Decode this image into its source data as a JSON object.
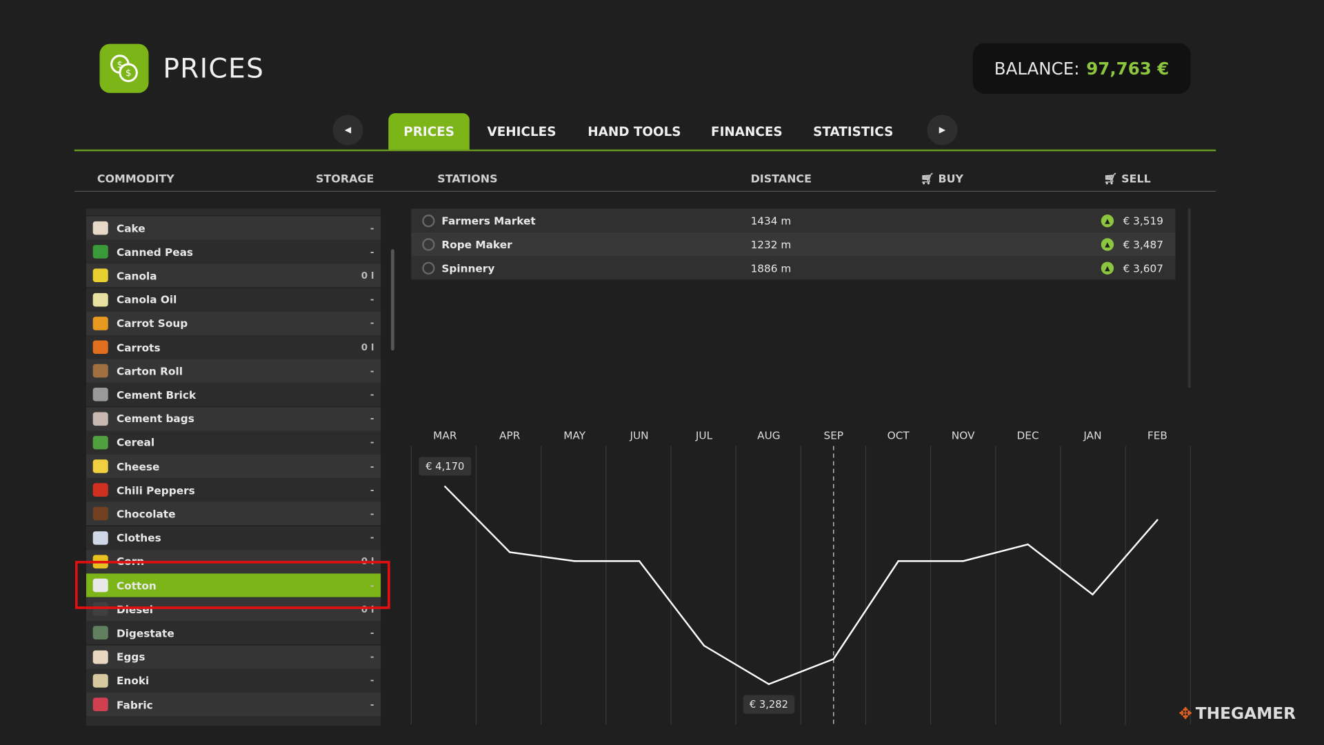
{
  "header": {
    "title": "PRICES",
    "balance_label": "BALANCE:",
    "balance_value": "97,763 €"
  },
  "tabs": [
    {
      "label": "PRICES",
      "active": true
    },
    {
      "label": "VEHICLES"
    },
    {
      "label": "HAND TOOLS"
    },
    {
      "label": "FINANCES"
    },
    {
      "label": "STATISTICS"
    }
  ],
  "columns": {
    "commodity": "COMMODITY",
    "storage": "STORAGE",
    "stations": "STATIONS",
    "distance": "DISTANCE",
    "buy": "BUY",
    "sell": "SELL"
  },
  "commodities": [
    {
      "name": "Cake",
      "storage": "-",
      "color": "#e8d8c8"
    },
    {
      "name": "Canned Peas",
      "storage": "-",
      "color": "#3a9a3a"
    },
    {
      "name": "Canola",
      "storage": "0 l",
      "color": "#e8d030"
    },
    {
      "name": "Canola Oil",
      "storage": "-",
      "color": "#e8e0a0"
    },
    {
      "name": "Carrot Soup",
      "storage": "-",
      "color": "#e89a20"
    },
    {
      "name": "Carrots",
      "storage": "0 l",
      "color": "#e07020"
    },
    {
      "name": "Carton Roll",
      "storage": "-",
      "color": "#a07040"
    },
    {
      "name": "Cement Brick",
      "storage": "-",
      "color": "#999999"
    },
    {
      "name": "Cement bags",
      "storage": "-",
      "color": "#c8b8b0"
    },
    {
      "name": "Cereal",
      "storage": "-",
      "color": "#50a040"
    },
    {
      "name": "Cheese",
      "storage": "-",
      "color": "#f0d040"
    },
    {
      "name": "Chili Peppers",
      "storage": "-",
      "color": "#d03020"
    },
    {
      "name": "Chocolate",
      "storage": "-",
      "color": "#704020"
    },
    {
      "name": "Clothes",
      "storage": "-",
      "color": "#d0d8e8"
    },
    {
      "name": "Corn",
      "storage": "0 l",
      "color": "#e8c020"
    },
    {
      "name": "Cotton",
      "storage": "-",
      "color": "#e8e8e8",
      "selected": true
    },
    {
      "name": "Diesel",
      "storage": "0 l",
      "color": "#404040"
    },
    {
      "name": "Digestate",
      "storage": "-",
      "color": "#608060"
    },
    {
      "name": "Eggs",
      "storage": "-",
      "color": "#e8d8c0"
    },
    {
      "name": "Enoki",
      "storage": "-",
      "color": "#d8c8a0"
    },
    {
      "name": "Fabric",
      "storage": "-",
      "color": "#d04050"
    }
  ],
  "stations": [
    {
      "name": "Farmers Market",
      "distance": "1434 m",
      "sell": "€ 3,519"
    },
    {
      "name": "Rope Maker",
      "distance": "1232 m",
      "sell": "€ 3,487"
    },
    {
      "name": "Spinnery",
      "distance": "1886 m",
      "sell": "€ 3,607"
    }
  ],
  "chart_data": {
    "type": "line",
    "categories": [
      "MAR",
      "APR",
      "MAY",
      "JUN",
      "JUL",
      "AUG",
      "SEP",
      "OCT",
      "NOV",
      "DEC",
      "JAN",
      "FEB"
    ],
    "values": [
      4170,
      3875,
      3835,
      3835,
      3455,
      3282,
      3395,
      3835,
      3835,
      3910,
      3685,
      4020
    ],
    "max_label": "€ 4,170",
    "min_label": "€ 3,282",
    "current_month": "SEP",
    "line_color": "#ffffff",
    "grid": "vertical"
  },
  "watermark": "THEGAMER",
  "colors": {
    "accent": "#7cb518",
    "balance": "#8cc63f",
    "highlight": "#e01010"
  }
}
